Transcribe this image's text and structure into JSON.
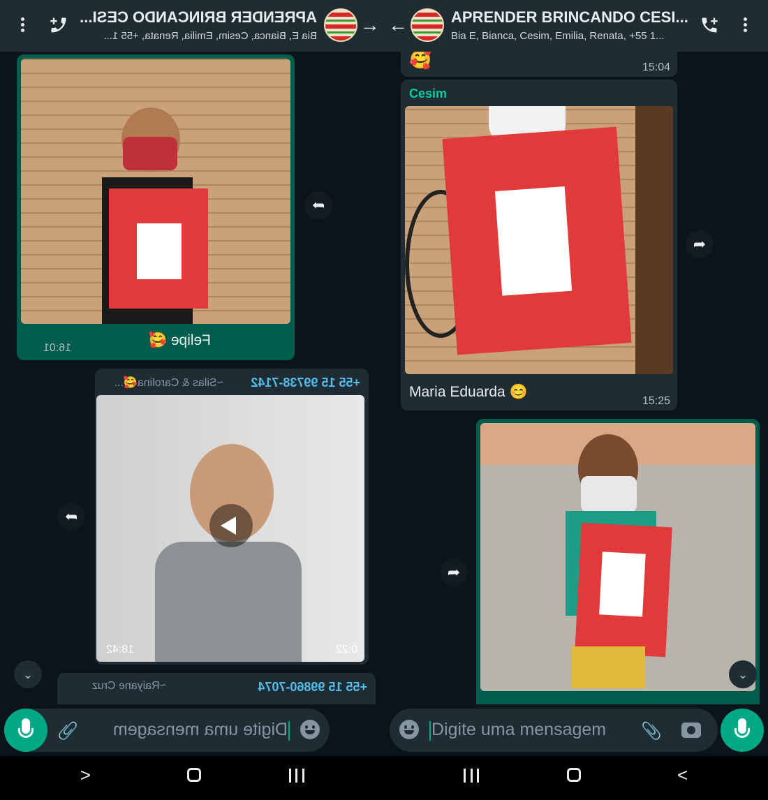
{
  "header": {
    "title": "APRENDER BRINCANDO CESI...",
    "subtitle": "Bia E, Bianca, Cesim, Emilia, Renata, +55 1..."
  },
  "left_chat": {
    "msg1": {
      "caption": "Felipe 🥰",
      "time": "16:01"
    },
    "msg2": {
      "sender": "+55 15 99738-7142",
      "alias": "~Silas & Carolina🥰...",
      "duration": "0:22",
      "time": "18:42"
    },
    "msg3": {
      "sender": "+55 15 99860-7074",
      "alias": "~Raiyane Cruz"
    }
  },
  "right_chat": {
    "msg0": {
      "emoji": "🥰",
      "time": "15:04"
    },
    "msg1": {
      "sender": "Cesim",
      "caption": "Maria Eduarda 😊",
      "time": "15:25"
    }
  },
  "composer": {
    "placeholder": "Digite uma mensagem"
  },
  "colors": {
    "header_bg": "#1f2c34",
    "chat_bg": "#0b141a",
    "outgoing_bubble": "#005c4b",
    "incoming_bubble": "#1f2c34",
    "accent": "#00a884"
  }
}
